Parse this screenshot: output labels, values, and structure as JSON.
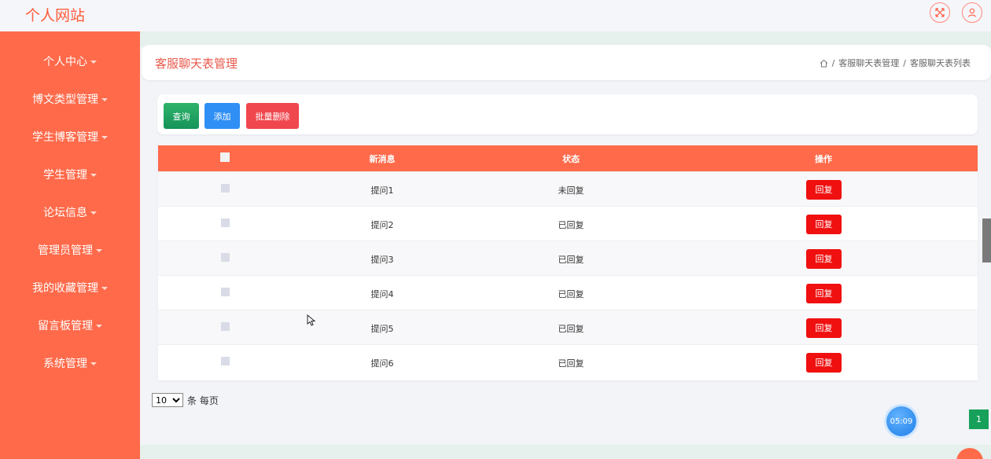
{
  "site": {
    "title": "个人网站"
  },
  "sidebar": {
    "items": [
      {
        "label": "个人中心"
      },
      {
        "label": "博文类型管理"
      },
      {
        "label": "学生博客管理"
      },
      {
        "label": "学生管理"
      },
      {
        "label": "论坛信息"
      },
      {
        "label": "管理员管理"
      },
      {
        "label": "我的收藏管理"
      },
      {
        "label": "留言板管理"
      },
      {
        "label": "系统管理"
      }
    ]
  },
  "header": {
    "title": "客服聊天表管理",
    "breadcrumb": [
      "客服聊天表管理",
      "客服聊天表列表"
    ],
    "separator": "/"
  },
  "toolbar": {
    "query_label": "查询",
    "add_label": "添加",
    "batch_delete_label": "批量删除"
  },
  "table": {
    "headers": {
      "message": "新消息",
      "status": "状态",
      "action": "操作"
    },
    "rows": [
      {
        "message": "提问1",
        "status": "未回复",
        "action": "回复"
      },
      {
        "message": "提问2",
        "status": "已回复",
        "action": "回复"
      },
      {
        "message": "提问3",
        "status": "已回复",
        "action": "回复"
      },
      {
        "message": "提问4",
        "status": "已回复",
        "action": "回复"
      },
      {
        "message": "提问5",
        "status": "已回复",
        "action": "回复"
      },
      {
        "message": "提问6",
        "status": "已回复",
        "action": "回复"
      }
    ]
  },
  "pager": {
    "page_size": "10",
    "suffix": "条 每页",
    "current_page": "1"
  },
  "timer": {
    "value": "05:09"
  },
  "colors": {
    "accent": "#ff6a4a",
    "title": "#e8584a",
    "reply": "#f01010",
    "query": "#16935a",
    "add": "#2f8ff5",
    "delete": "#f0474e"
  }
}
